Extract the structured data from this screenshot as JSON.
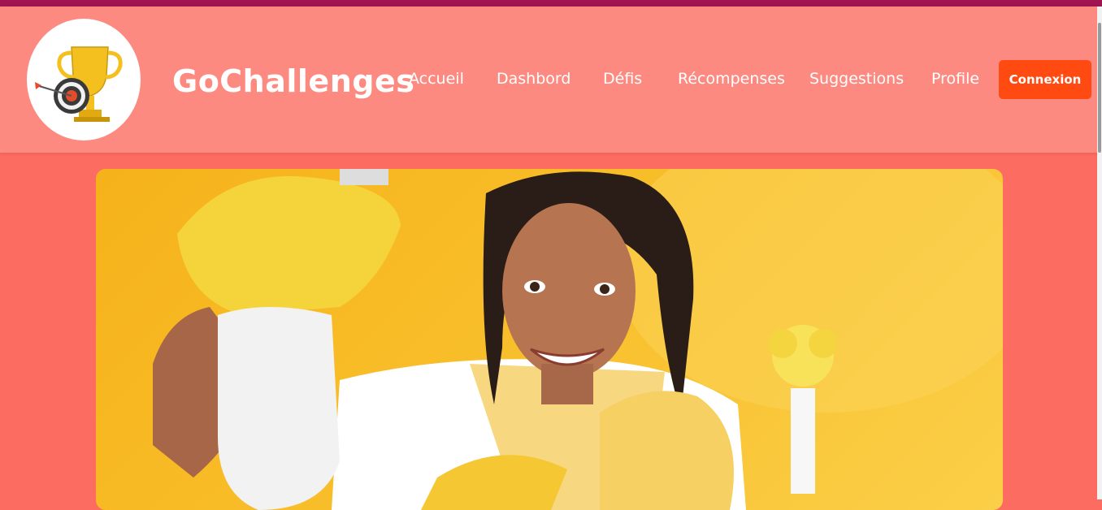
{
  "header": {
    "brand": "GoChallenges",
    "logo_icon": "trophy-target-icon",
    "nav": [
      {
        "label": "Accueil"
      },
      {
        "label": "Dashbord"
      },
      {
        "label": "Défis"
      },
      {
        "label": "Récompenses"
      },
      {
        "label": "Suggestions"
      },
      {
        "label": "Profile"
      }
    ],
    "login_label": "Connexion"
  },
  "hero": {
    "image": "smiling-woman-cleaning-photo"
  },
  "colors": {
    "topbar": "#a0154f",
    "header_bg": "#fd8a80",
    "page_bg": "#fd6c60",
    "button": "#ff4a12",
    "hero_bg": "#f6b21a"
  }
}
